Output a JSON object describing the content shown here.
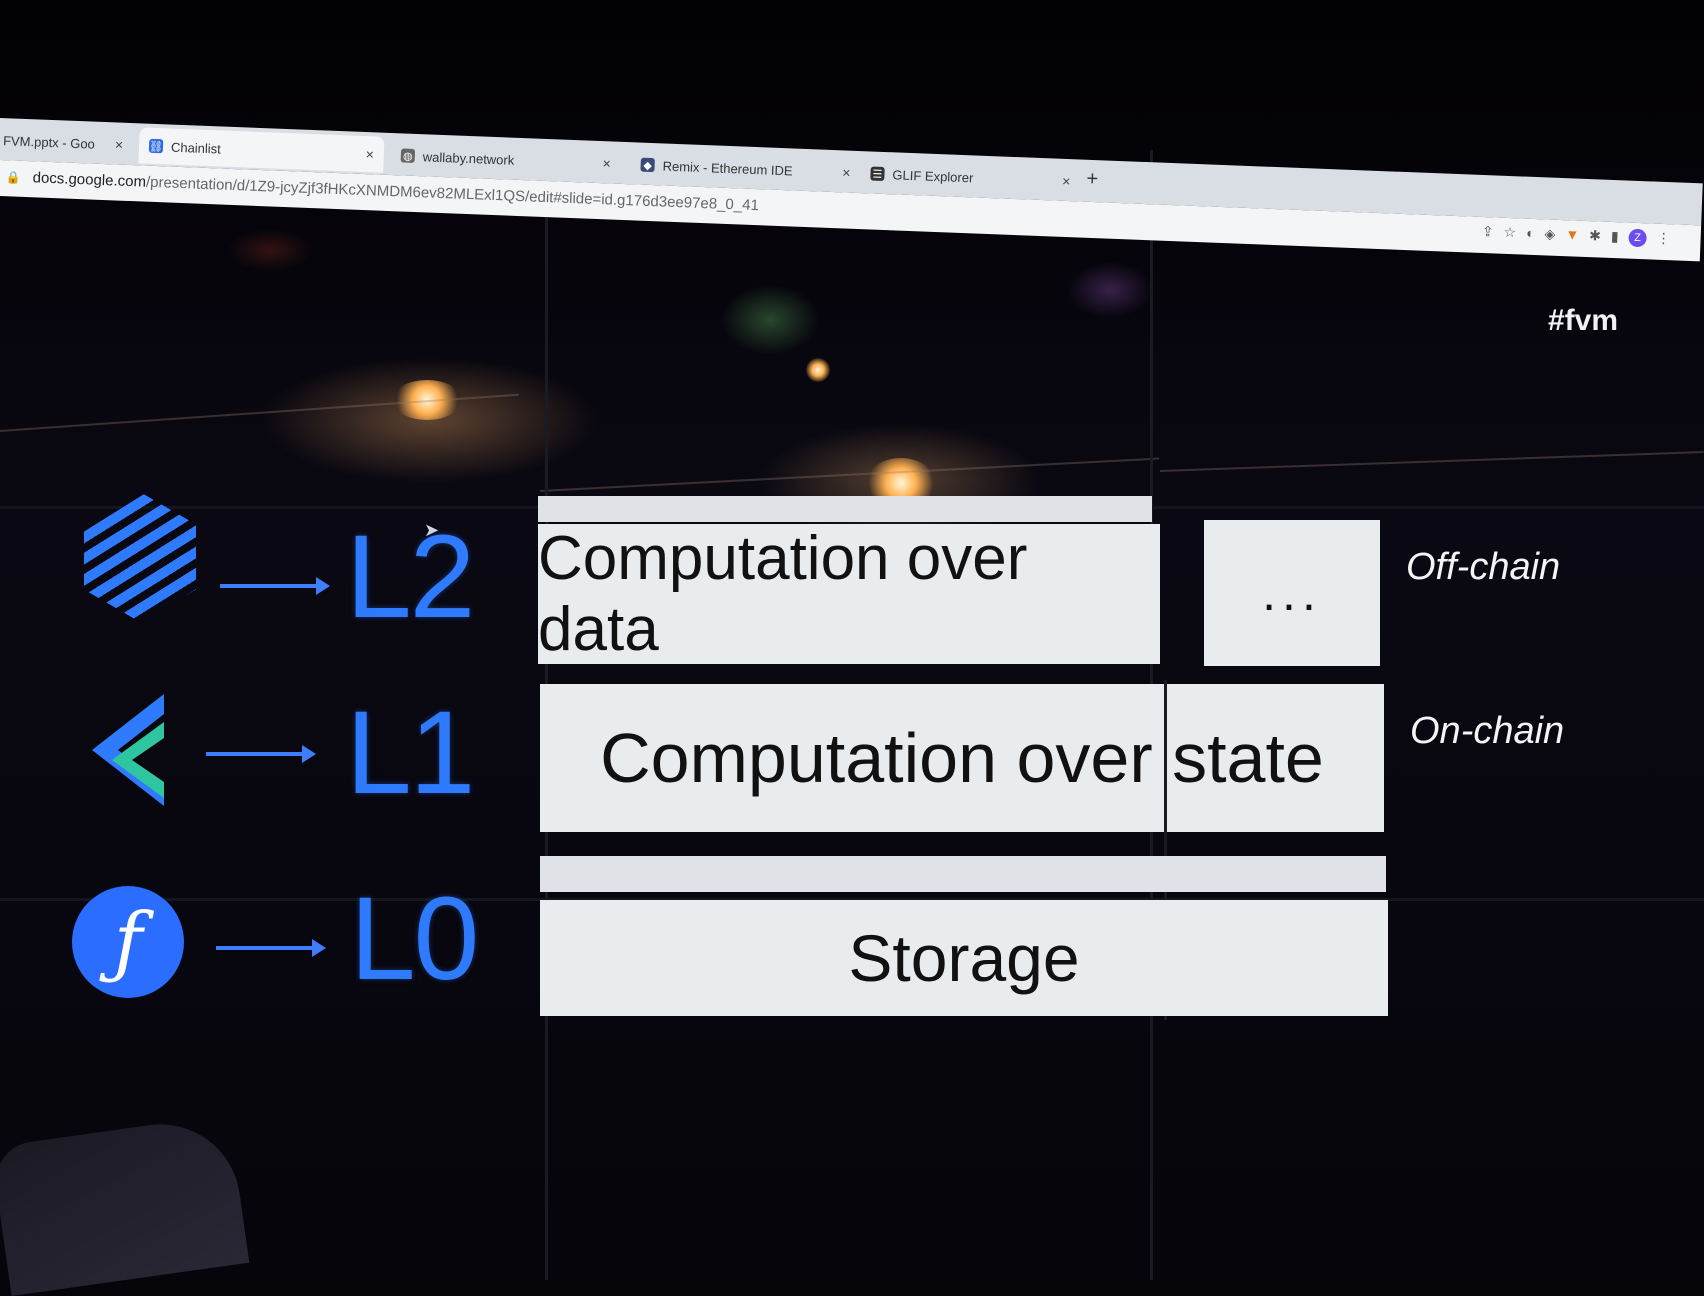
{
  "browser": {
    "tabs": [
      {
        "label": "FVM.pptx - Goo",
        "icon": "slides-icon",
        "close": "×"
      },
      {
        "label": "Chainlist",
        "icon": "chainlist-icon",
        "close": "×"
      },
      {
        "label": "wallaby.network",
        "icon": "globe-icon",
        "close": "×"
      },
      {
        "label": "Remix - Ethereum IDE",
        "icon": "remix-icon",
        "close": "×"
      },
      {
        "label": "GLIF Explorer",
        "icon": "glif-icon",
        "close": "×"
      }
    ],
    "new_tab": "+",
    "url_host": "docs.google.com",
    "url_path": "/presentation/d/1Z9-jcyZjf3fHKcXNMDM6ev82MLExl1QS/edit#slide=id.g176d3ee97e8_0_41",
    "profile_initial": "Z",
    "toolbar_icons": [
      "share-icon",
      "star-icon",
      "extension-icon",
      "shield-icon",
      "fox-icon",
      "puzzle-icon",
      "sidebar-icon",
      "profile-icon",
      "menu-icon"
    ]
  },
  "slide": {
    "hashtag": "#fvm",
    "layers": [
      {
        "label": "L2",
        "logo": "hexagon-logo-icon",
        "box_text": "Computation over data",
        "extra_text": "...",
        "side": "Off-chain"
      },
      {
        "label": "L1",
        "logo": "ethereum-logo-icon",
        "box_text": "Computation over state",
        "side": "On-chain"
      },
      {
        "label": "L0",
        "logo": "filecoin-logo-icon",
        "box_text": "Storage",
        "filecoin_glyph": "ƒ"
      }
    ]
  },
  "colors": {
    "accent_blue": "#2f7bff",
    "box_fill": "#e9ecef",
    "background": "#050409"
  }
}
